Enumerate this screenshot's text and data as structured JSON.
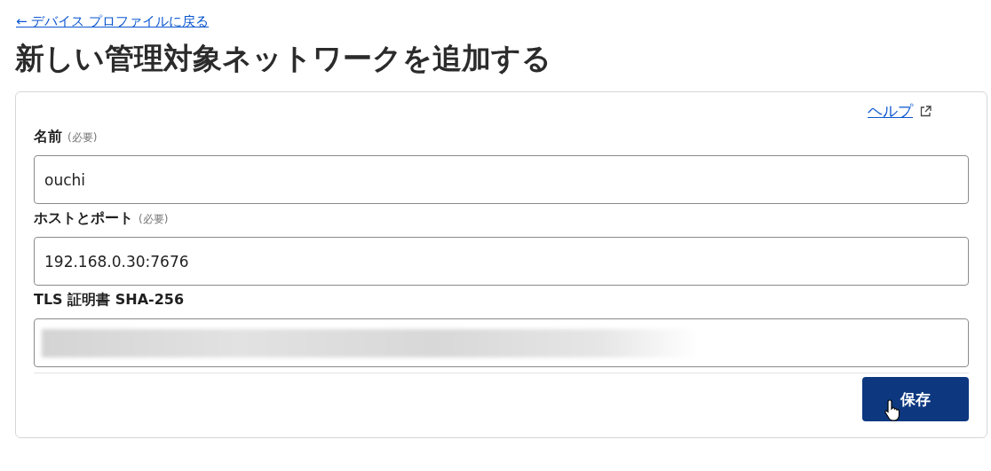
{
  "back_link": "← デバイス プロファイルに戻る",
  "title": "新しい管理対象ネットワークを追加する",
  "help_link": "ヘルプ",
  "fields": [
    {
      "kind": "text",
      "label": "名前",
      "required_note": "(必要)",
      "value": "ouchi"
    },
    {
      "kind": "text",
      "label": "ホストとポート",
      "required_note": "(必要)",
      "value": "192.168.0.30:7676"
    },
    {
      "kind": "redacted",
      "label": "TLS 証明書 SHA-256"
    }
  ],
  "save_button": "保存"
}
